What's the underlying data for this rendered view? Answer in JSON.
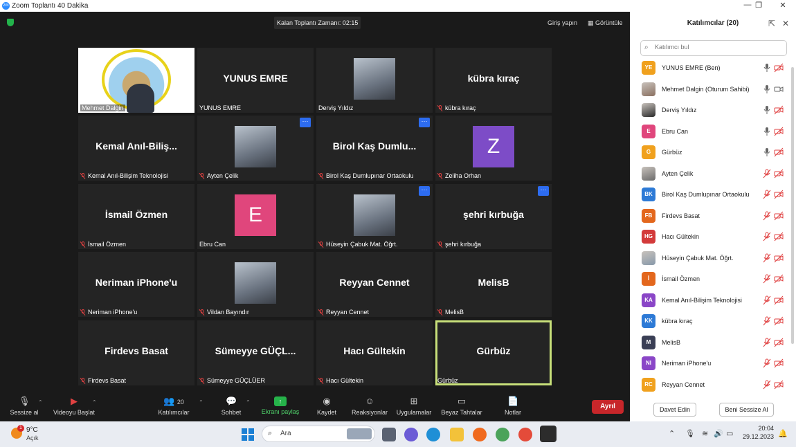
{
  "window": {
    "title": "Zoom Toplantı 40 Dakika"
  },
  "meeting": {
    "timer_label": "Kalan Toplantı Zamanı: 02:15",
    "signin_label": "Giriş yapın",
    "view_label": "Görüntüle"
  },
  "tiles": [
    {
      "label": "Mehmet Dalgin",
      "big": "",
      "kind": "logo-video",
      "muted": false
    },
    {
      "label": "YUNUS EMRE",
      "big": "YUNUS EMRE",
      "kind": "name",
      "muted": false
    },
    {
      "label": "Derviş Yıldız",
      "big": "",
      "kind": "photo",
      "muted": false
    },
    {
      "label": "kübra kıraç",
      "big": "kübra kıraç",
      "kind": "name",
      "muted": true
    },
    {
      "label": "Kemal Anıl-Bilişim Teknolojisi",
      "big": "Kemal  Anıl-Biliş...",
      "kind": "name",
      "muted": true
    },
    {
      "label": "Ayten Çelik",
      "big": "",
      "kind": "photo",
      "muted": true,
      "dots": true
    },
    {
      "label": "Birol Kaş Dumlupınar Ortaokulu",
      "big": "Birol  Kaş  Dumlu...",
      "kind": "name",
      "muted": true,
      "dots": true
    },
    {
      "label": "Zeliha Orhan",
      "big": "Z",
      "kind": "avatar",
      "color": "#7d4cc7",
      "muted": true
    },
    {
      "label": "İsmail Özmen",
      "big": "İsmail Özmen",
      "kind": "name",
      "muted": true
    },
    {
      "label": "Ebru Can",
      "big": "E",
      "kind": "avatar",
      "color": "#e0467c",
      "muted": false
    },
    {
      "label": "Hüseyin Çabuk Mat. Öğrt.",
      "big": "",
      "kind": "photo",
      "muted": true,
      "dots": true
    },
    {
      "label": "şehri kırbuğa",
      "big": "şehri kırbuğa",
      "kind": "name",
      "muted": true,
      "dots": true
    },
    {
      "label": "Neriman iPhone'u",
      "big": "Neriman iPhone'u",
      "kind": "name",
      "muted": true
    },
    {
      "label": "Vildan Bayındır",
      "big": "",
      "kind": "photo",
      "muted": true
    },
    {
      "label": "Reyyan Cennet",
      "big": "Reyyan Cennet",
      "kind": "name",
      "muted": true
    },
    {
      "label": "MelisB",
      "big": "MelisB",
      "kind": "name",
      "muted": true
    },
    {
      "label": "Firdevs Basat",
      "big": "Firdevs Basat",
      "kind": "name",
      "muted": true
    },
    {
      "label": "Sümeyye GÜÇLÜER",
      "big": "Sümeyye  GÜÇL...",
      "kind": "name",
      "muted": true
    },
    {
      "label": "Hacı Gültekin",
      "big": "Hacı Gültekin",
      "kind": "name",
      "muted": true
    },
    {
      "label": "Gürbüz",
      "big": "Gürbüz",
      "kind": "name",
      "muted": false,
      "active": true
    }
  ],
  "toolbar": {
    "mute": "Sessize al",
    "video": "Videoyu Başlat",
    "participants": "Katılımcılar",
    "participants_count": "20",
    "chat": "Sohbet",
    "share": "Ekranı paylaş",
    "record": "Kaydet",
    "reactions": "Reaksiyonlar",
    "apps": "Uygulamalar",
    "whiteboards": "Beyaz Tahtalar",
    "notes": "Notlar",
    "end": "Ayrıl"
  },
  "panel": {
    "title": "Katılımcılar (20)",
    "search_placeholder": "Katılımcı bul",
    "invite": "Davet Edin",
    "mute_all": "Beni Sessize Al",
    "participants": [
      {
        "initials": "YE",
        "name": "YUNUS EMRE (Ben)",
        "color": "#f0a11e",
        "mic": "on",
        "cam": "off"
      },
      {
        "initials": "",
        "name": "Mehmet Dalgin (Oturum Sahibi)",
        "color": "#8a7060",
        "mic": "on",
        "cam": "on",
        "photo": true
      },
      {
        "initials": "",
        "name": "Derviş Yıldız",
        "color": "#2a2a2a",
        "mic": "on",
        "cam": "off",
        "photo": true
      },
      {
        "initials": "E",
        "name": "Ebru Can",
        "color": "#e0467c",
        "mic": "on",
        "cam": "off"
      },
      {
        "initials": "G",
        "name": "Gürbüz",
        "color": "#f0a11e",
        "mic": "on",
        "cam": "off"
      },
      {
        "initials": "",
        "name": "Ayten Çelik",
        "color": "#6b6b6b",
        "mic": "off",
        "cam": "off",
        "photo": true
      },
      {
        "initials": "BK",
        "name": "Birol Kaş Dumlupınar Ortaokulu",
        "color": "#2d7ad6",
        "mic": "off",
        "cam": "off"
      },
      {
        "initials": "FB",
        "name": "Firdevs Basat",
        "color": "#e3671d",
        "mic": "off",
        "cam": "off"
      },
      {
        "initials": "HG",
        "name": "Hacı Gültekin",
        "color": "#d33a3a",
        "mic": "off",
        "cam": "off"
      },
      {
        "initials": "",
        "name": "Hüseyin Çabuk Mat. Öğrt.",
        "color": "#8899aa",
        "mic": "off",
        "cam": "off",
        "photo": true
      },
      {
        "initials": "İ",
        "name": "İsmail Özmen",
        "color": "#e3671d",
        "mic": "off",
        "cam": "off"
      },
      {
        "initials": "KA",
        "name": "Kemal Anıl-Bilişim Teknolojisi",
        "color": "#8a46c7",
        "mic": "off",
        "cam": "off"
      },
      {
        "initials": "KK",
        "name": "kübra kıraç",
        "color": "#2d7ad6",
        "mic": "off",
        "cam": "off"
      },
      {
        "initials": "M",
        "name": "MelisB",
        "color": "#3a3f55",
        "mic": "off",
        "cam": "off"
      },
      {
        "initials": "NI",
        "name": "Neriman iPhone'u",
        "color": "#8a46c7",
        "mic": "off",
        "cam": "off"
      },
      {
        "initials": "RC",
        "name": "Reyyan Cennet",
        "color": "#f0a11e",
        "mic": "off",
        "cam": "off"
      }
    ]
  },
  "taskbar": {
    "weather_temp": "9°C",
    "weather_desc": "Açık",
    "weather_badge": "1",
    "search_label": "Ara",
    "time": "20:04",
    "date": "29.12.2023"
  }
}
